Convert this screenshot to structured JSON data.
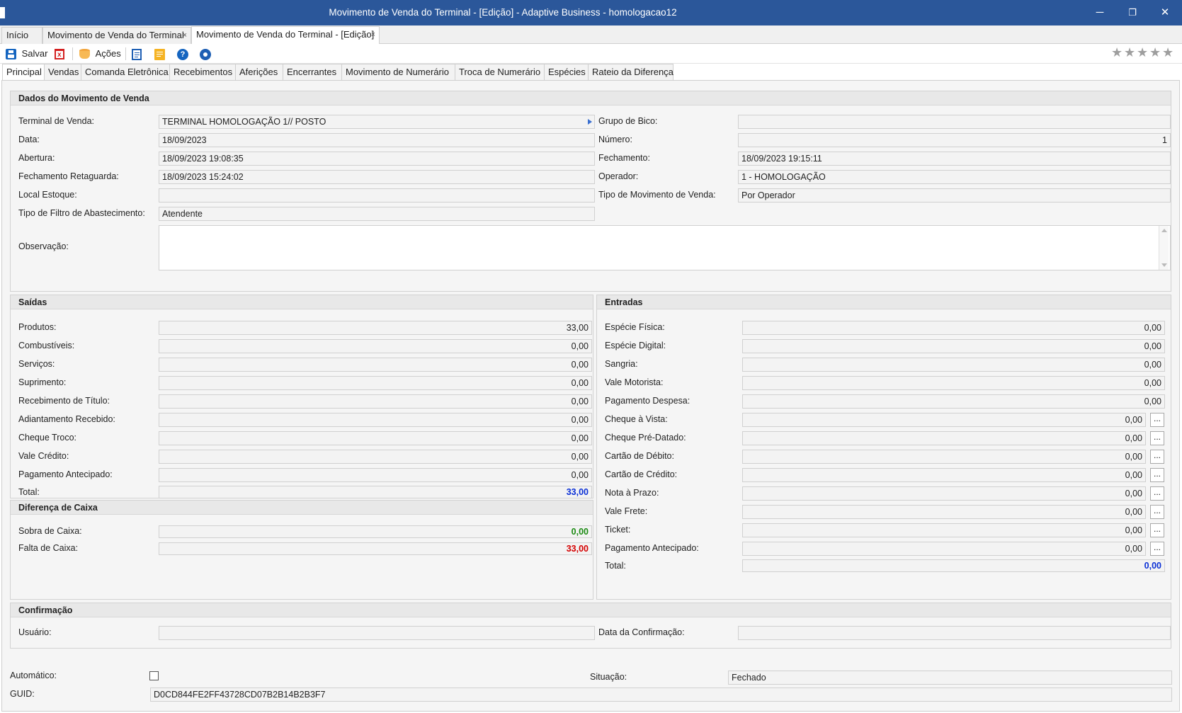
{
  "window": {
    "title": "Movimento de Venda do Terminal - [Edição] - Adaptive Business - homologacao12",
    "minimize": "─",
    "maximize": "❐",
    "close": "✕"
  },
  "doc_tabs": [
    {
      "label": "Início"
    },
    {
      "label": "Movimento de Venda do Terminal"
    },
    {
      "label": "Movimento de Venda do Terminal - [Edição]"
    }
  ],
  "close_glyph": "×",
  "toolbar": {
    "save_label": "Salvar",
    "actions_label": "Ações",
    "rating_star": "★"
  },
  "sec_tabs": [
    {
      "label": "Principal"
    },
    {
      "label": "Vendas"
    },
    {
      "label": "Comanda Eletrônica"
    },
    {
      "label": "Recebimentos"
    },
    {
      "label": "Aferições"
    },
    {
      "label": "Encerrantes"
    },
    {
      "label": "Movimento de Numerário"
    },
    {
      "label": "Troca de Numerário"
    },
    {
      "label": "Espécies"
    },
    {
      "label": "Rateio da Diferença"
    }
  ],
  "dados": {
    "header": "Dados do Movimento de Venda",
    "terminal_label": "Terminal de Venda:",
    "terminal_value": "TERMINAL HOMOLOGAÇÃO 1// POSTO",
    "grupo_bico_label": "Grupo de Bico:",
    "grupo_bico_value": "",
    "data_label": "Data:",
    "data_value": "18/09/2023",
    "numero_label": "Número:",
    "numero_value": "1",
    "abertura_label": "Abertura:",
    "abertura_value": "18/09/2023 19:08:35",
    "fechamento_label": "Fechamento:",
    "fechamento_value": "18/09/2023 19:15:11",
    "fech_retaguarda_label": "Fechamento Retaguarda:",
    "fech_retaguarda_value": "18/09/2023 15:24:02",
    "operador_label": "Operador:",
    "operador_value": "1 - HOMOLOGAÇÃO",
    "local_estoque_label": "Local Estoque:",
    "local_estoque_value": "",
    "tipo_mov_label": "Tipo de Movimento de Venda:",
    "tipo_mov_value": "Por Operador",
    "tipo_filtro_label": "Tipo de Filtro de Abastecimento:",
    "tipo_filtro_value": "Atendente",
    "observacao_label": "Observação:",
    "observacao_value": ""
  },
  "saidas": {
    "header": "Saídas",
    "rows": [
      {
        "label": "Produtos:",
        "value": "33,00"
      },
      {
        "label": "Combustíveis:",
        "value": "0,00"
      },
      {
        "label": "Serviços:",
        "value": "0,00"
      },
      {
        "label": "Suprimento:",
        "value": "0,00"
      },
      {
        "label": "Recebimento de Título:",
        "value": "0,00"
      },
      {
        "label": "Adiantamento Recebido:",
        "value": "0,00"
      },
      {
        "label": "Cheque Troco:",
        "value": "0,00"
      },
      {
        "label": "Vale Crédito:",
        "value": "0,00"
      },
      {
        "label": "Pagamento Antecipado:",
        "value": "0,00"
      }
    ],
    "total_label": "Total:",
    "total_value": "33,00"
  },
  "entradas": {
    "header": "Entradas",
    "rows": [
      {
        "label": "Espécie Física:",
        "value": "0,00"
      },
      {
        "label": "Espécie Digital:",
        "value": "0,00"
      },
      {
        "label": "Sangria:",
        "value": "0,00"
      },
      {
        "label": "Vale Motorista:",
        "value": "0,00"
      },
      {
        "label": "Pagamento Despesa:",
        "value": "0,00"
      },
      {
        "label": "Cheque à Vista:",
        "value": "0,00"
      },
      {
        "label": "Cheque Pré-Datado:",
        "value": "0,00"
      },
      {
        "label": "Cartão de Débito:",
        "value": "0,00"
      },
      {
        "label": "Cartão de Crédito:",
        "value": "0,00"
      },
      {
        "label": "Nota à Prazo:",
        "value": "0,00"
      },
      {
        "label": "Vale Frete:",
        "value": "0,00"
      },
      {
        "label": "Ticket:",
        "value": "0,00"
      },
      {
        "label": "Pagamento Antecipado:",
        "value": "0,00"
      }
    ],
    "total_label": "Total:",
    "total_value": "0,00",
    "more_button": "..."
  },
  "diferenca": {
    "header": "Diferença de Caixa",
    "sobra_label": "Sobra de Caixa:",
    "sobra_value": "0,00",
    "falta_label": "Falta de Caixa:",
    "falta_value": "33,00"
  },
  "confirmacao": {
    "header": "Confirmação",
    "usuario_label": "Usuário:",
    "usuario_value": "",
    "data_conf_label": "Data da Confirmação:",
    "data_conf_value": ""
  },
  "footer": {
    "automatico_label": "Automático:",
    "automatico_checked": false,
    "situacao_label": "Situação:",
    "situacao_value": "Fechado",
    "guid_label": "GUID:",
    "guid_value": "D0CD844FE2FF43728CD07B2B14B2B3F7"
  },
  "colors": {
    "titlebar": "#2b579a",
    "total_blue": "#0a2fd6",
    "sobra_green": "#1b8a12",
    "falta_red": "#d40000"
  }
}
